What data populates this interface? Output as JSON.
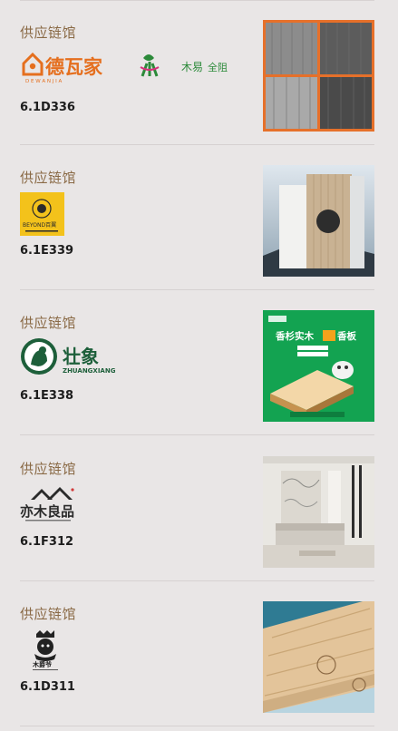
{
  "items": [
    {
      "label": "供应链馆",
      "code": "6.1D336",
      "logo_texts": [
        "德瓦家",
        "D E W A N J I A",
        "木易",
        "全阻"
      ]
    },
    {
      "label": "供应链馆",
      "code": "6.1E339",
      "logo_texts": [
        "BEYOND百翼"
      ]
    },
    {
      "label": "供应链馆",
      "code": "6.1E338",
      "logo_texts": [
        "壮象",
        "ZHUANGXIANG"
      ]
    },
    {
      "label": "供应链馆",
      "code": "6.1F312",
      "logo_texts": [
        "亦木良品"
      ]
    },
    {
      "label": "供应链馆",
      "code": "6.1D311",
      "logo_texts": [
        "木爵爷"
      ]
    }
  ],
  "poster_texts": {
    "title": "香杉实木",
    "title2": "香板"
  },
  "colors": {
    "background": "#e9e6e6",
    "label": "#8a6a46",
    "code": "#1d1d1d",
    "dewanjia_orange": "#e56f1e",
    "zhuang_green": "#1d5f3a",
    "poster_green": "#13a351"
  }
}
